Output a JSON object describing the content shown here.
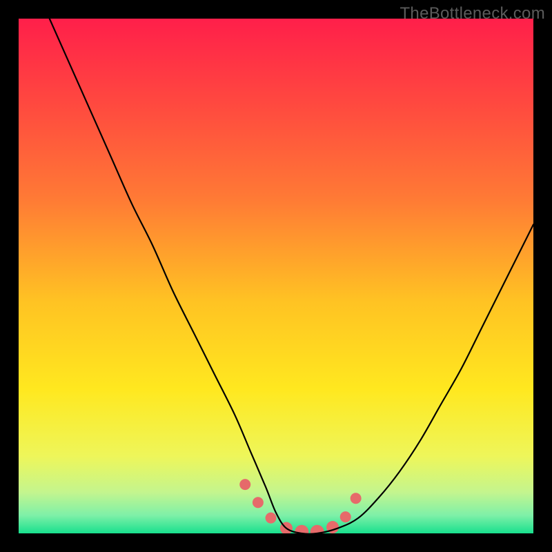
{
  "watermark": "TheBottleneck.com",
  "colors": {
    "frame": "#000000",
    "gradient_stops": [
      {
        "offset": 0.0,
        "color": "#ff1f4a"
      },
      {
        "offset": 0.17,
        "color": "#ff4a3f"
      },
      {
        "offset": 0.35,
        "color": "#ff7a35"
      },
      {
        "offset": 0.55,
        "color": "#ffc323"
      },
      {
        "offset": 0.72,
        "color": "#ffe81f"
      },
      {
        "offset": 0.85,
        "color": "#eef65a"
      },
      {
        "offset": 0.92,
        "color": "#c4f58e"
      },
      {
        "offset": 0.965,
        "color": "#7ef0a8"
      },
      {
        "offset": 1.0,
        "color": "#18e08e"
      }
    ],
    "curve": "#000000",
    "marker_fill": "#e66a6a",
    "marker_stroke": "#d24f4f"
  },
  "chart_data": {
    "type": "line",
    "title": "",
    "xlabel": "",
    "ylabel": "",
    "xlim": [
      0,
      100
    ],
    "ylim": [
      0,
      100
    ],
    "grid": false,
    "series": [
      {
        "name": "curve",
        "x": [
          6,
          10,
          14,
          18,
          22,
          26,
          30,
          34,
          38,
          42,
          45,
          48,
          50,
          52,
          55,
          58,
          62,
          66,
          70,
          74,
          78,
          82,
          86,
          90,
          94,
          98,
          100
        ],
        "y": [
          100,
          91,
          82,
          73,
          64,
          56,
          47,
          39,
          31,
          23,
          16,
          9,
          4,
          1,
          0,
          0,
          1,
          3,
          7,
          12,
          18,
          25,
          32,
          40,
          48,
          56,
          60
        ]
      }
    ],
    "markers": {
      "name": "highlight",
      "x": [
        44,
        46.5,
        49,
        52,
        55,
        58,
        61,
        63.5,
        65.5
      ],
      "y": [
        9.5,
        6,
        3,
        1,
        0.3,
        0.3,
        1.2,
        3.2,
        6.8
      ],
      "r": [
        8,
        8,
        8,
        9,
        10,
        10,
        9,
        8,
        8
      ]
    }
  }
}
